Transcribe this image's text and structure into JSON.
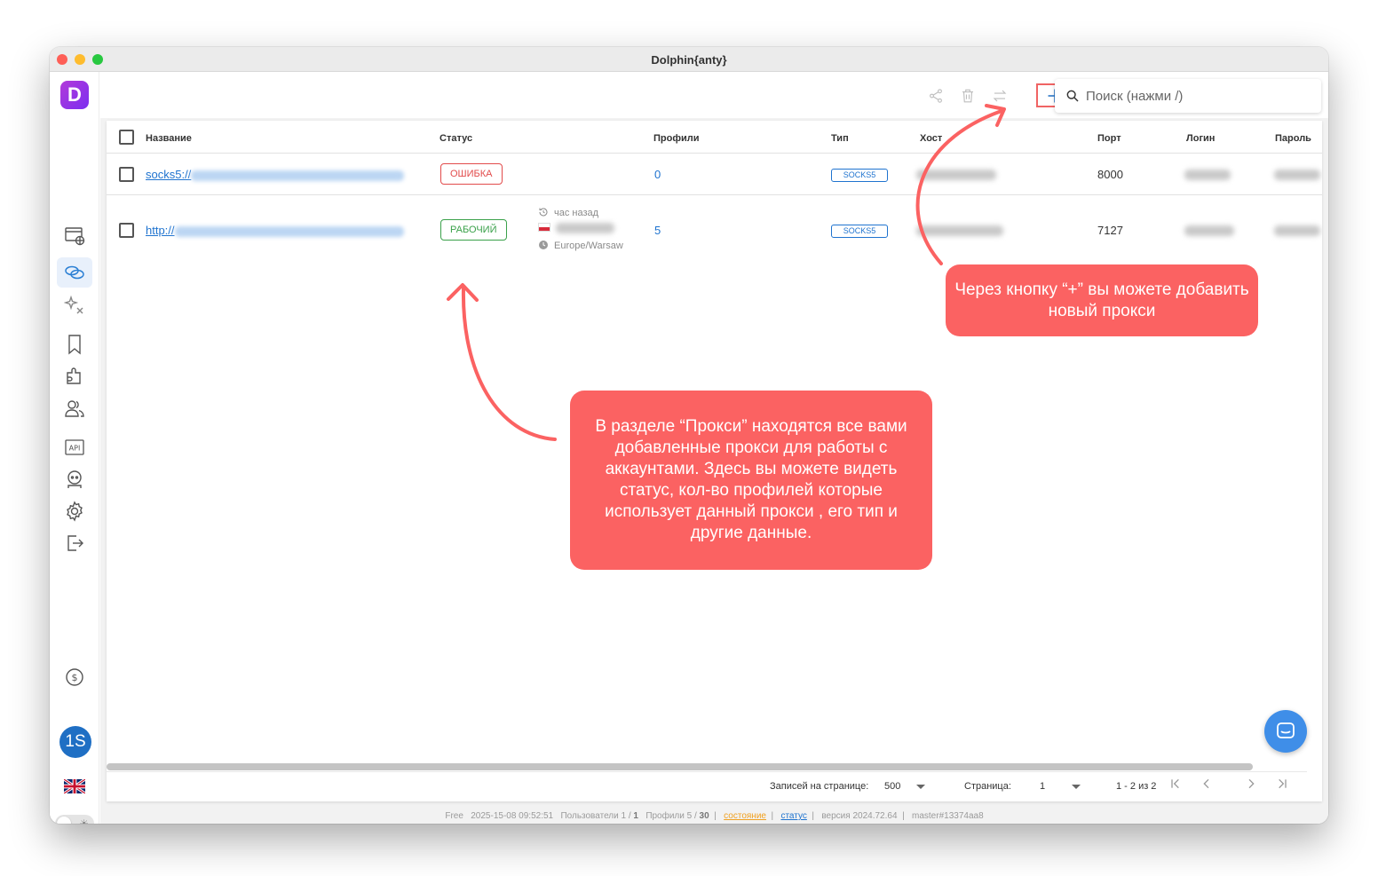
{
  "window": {
    "title": "Dolphin{anty}"
  },
  "sidebar": {
    "logo_letter": "D",
    "avatar_initials": "1S"
  },
  "toolbar": {
    "search_placeholder": "Поиск (нажми /)"
  },
  "table": {
    "columns": [
      "Название",
      "Статус",
      "Профили",
      "Тип",
      "Хост",
      "Порт",
      "Логин",
      "Пароль"
    ],
    "rows": [
      {
        "name": "socks5://",
        "status": "ОШИБКА",
        "profiles": "0",
        "type": "SOCKS5",
        "port": "8000"
      },
      {
        "name": "http://",
        "status": "РАБОЧИЙ",
        "checked_ago": "час назад",
        "timezone": "Europe/Warsaw",
        "profiles": "5",
        "type": "SOCKS5",
        "port": "7127"
      }
    ]
  },
  "pagination": {
    "rows_per_page_label": "Записей на странице:",
    "rows_per_page": "500",
    "page_label": "Страница:",
    "page": "1",
    "range": "1 - 2 из 2"
  },
  "statusbar": {
    "plan": "Free",
    "datetime": "2025-15-08 09:52:51",
    "users_label": "Пользователи 1 /",
    "users_limit": "1",
    "profiles_label": "Профили 5 /",
    "profiles_limit": "30",
    "state_link": "состояние",
    "status_link": "статус",
    "version": "версия 2024.72.64",
    "build": "master#13374aa8"
  },
  "annotations": {
    "add_button_note": "Через кнопку “+” вы можете добавить новый прокси",
    "section_note": "В разделе “Прокси” находятся все вами добавленные прокси для работы с аккаунтами. Здесь вы можете видеть статус, кол-во профилей которые использует данный прокси , его тип и другие данные."
  },
  "colors": {
    "accent": "#1f73cf",
    "error": "#e24b4b",
    "success": "#3aa14a",
    "callout": "#fb6262",
    "brand": "#9b35e3"
  },
  "icons": [
    "share-icon",
    "trash-icon",
    "swap-icon",
    "plus-icon",
    "search-icon",
    "history-icon",
    "clock-icon",
    "chat-icon"
  ]
}
